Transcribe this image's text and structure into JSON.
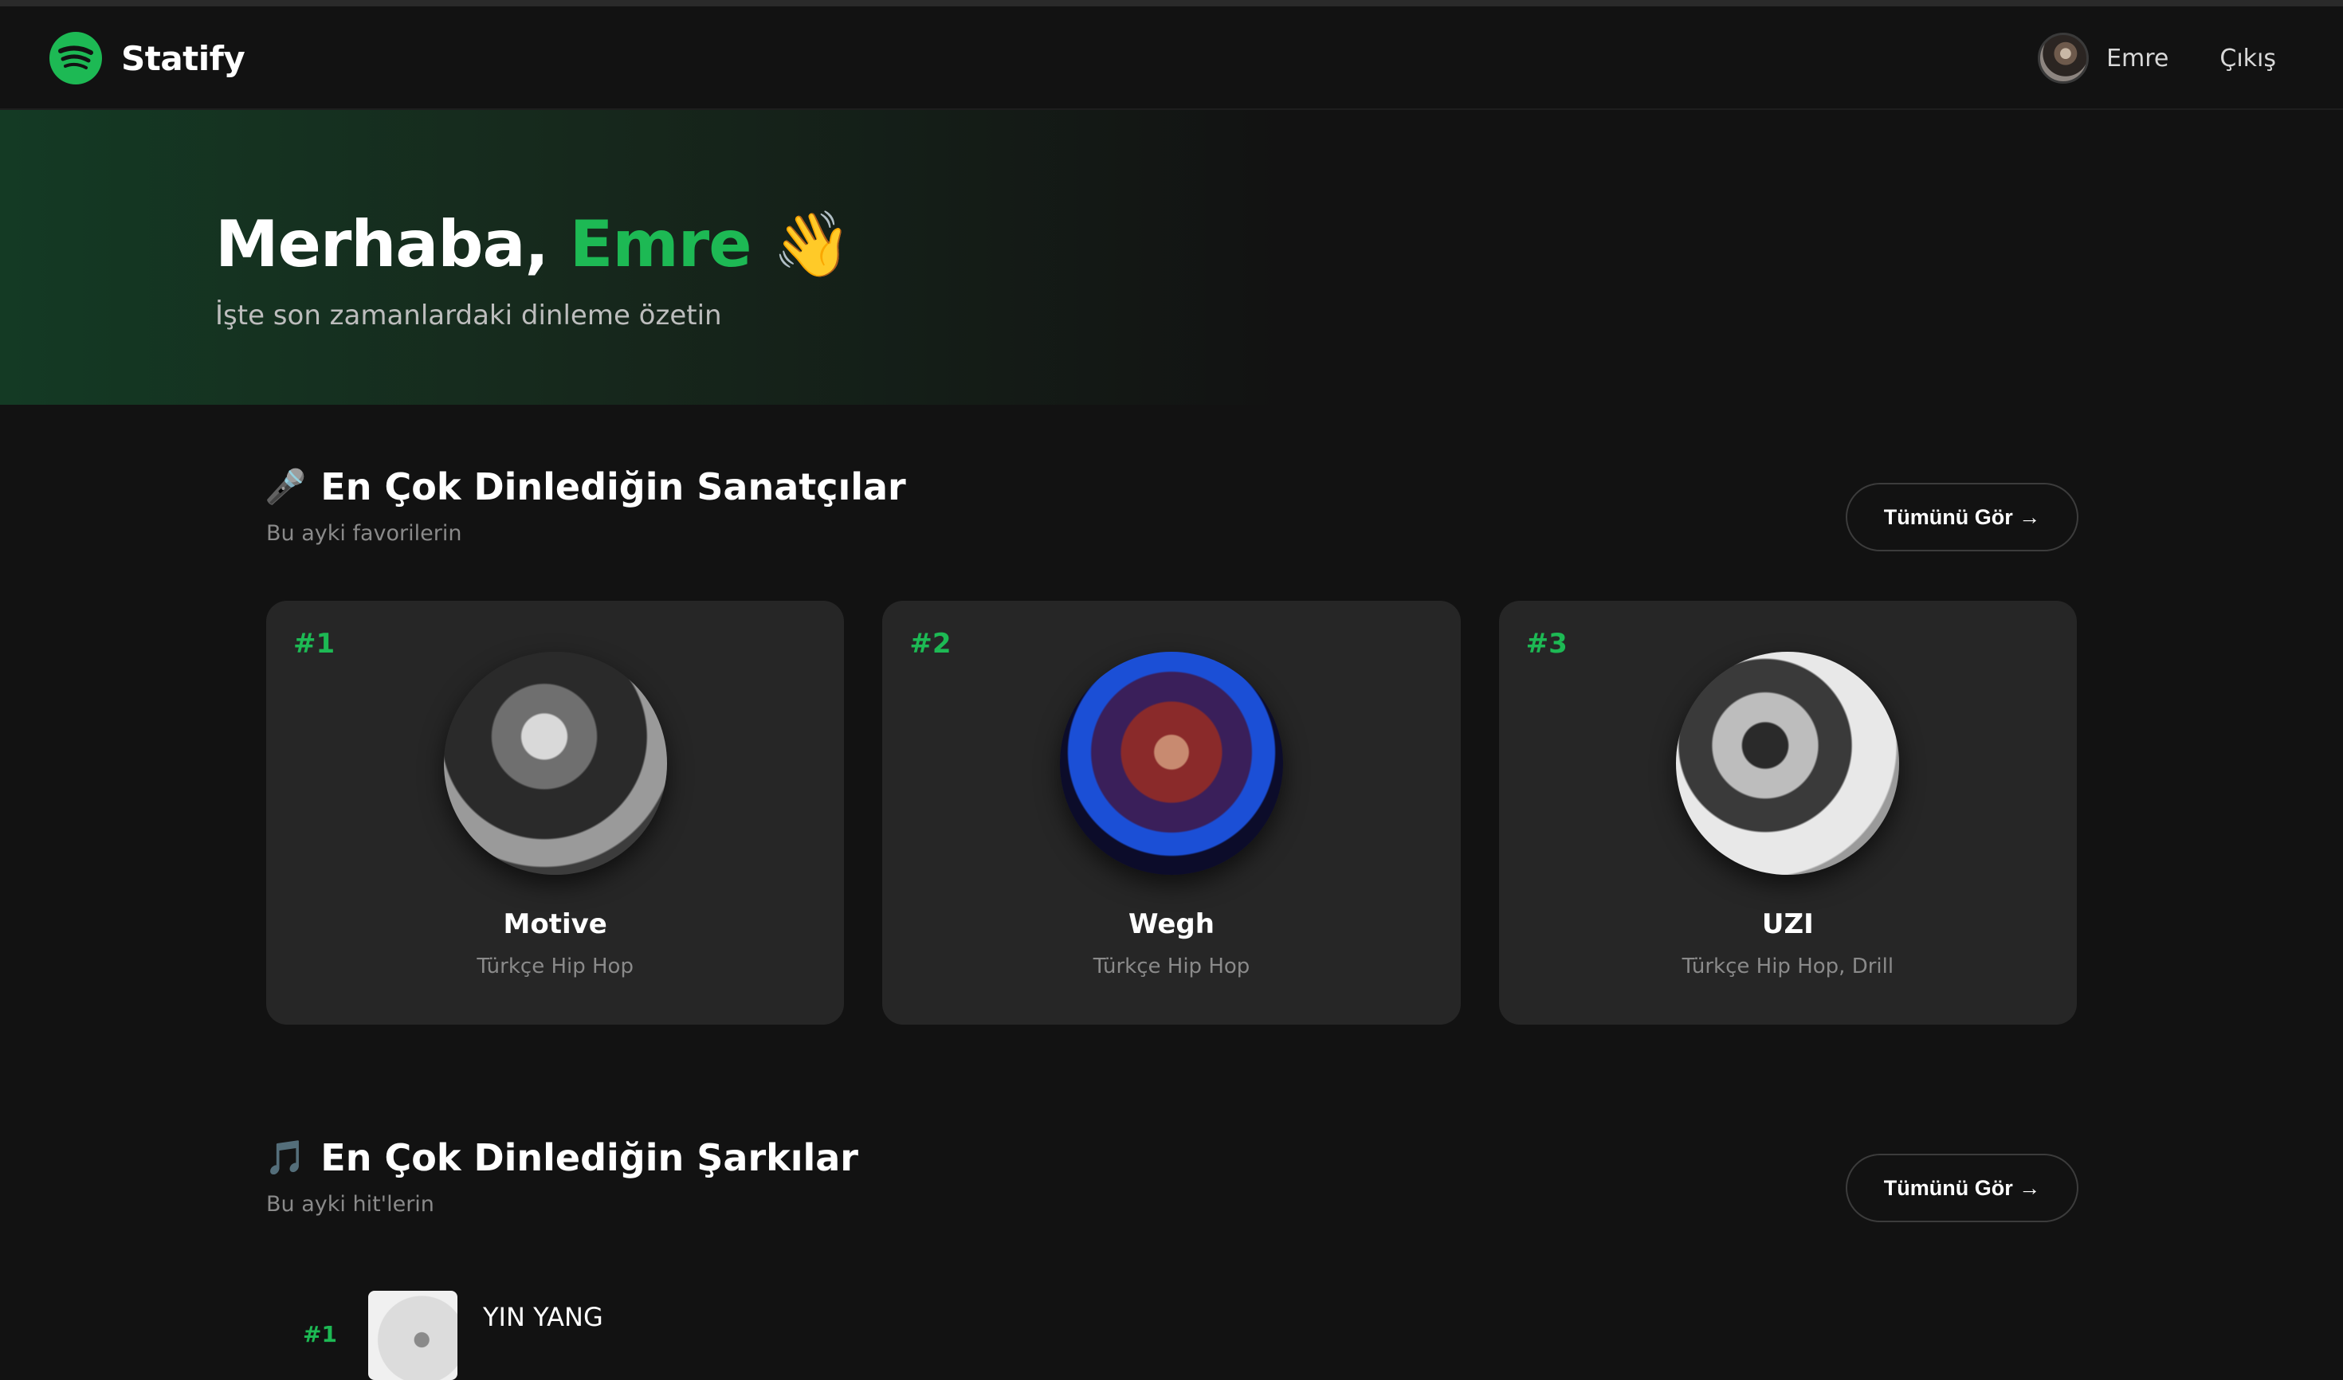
{
  "app": {
    "name": "Statify"
  },
  "nav": {
    "user_name": "Emre",
    "logout_label": "Çıkış"
  },
  "hero": {
    "greeting": "Merhaba, ",
    "name": "Emre",
    "emoji": "👋",
    "subtitle": "İşte son zamanlardaki dinleme özetin"
  },
  "artists_section": {
    "icon": "🎤",
    "title": "En Çok Dinlediğin Sanatçılar",
    "subtitle": "Bu ayki favorilerin",
    "see_all": "Tümünü Gör →",
    "items": [
      {
        "rank": "#1",
        "name": "Motive",
        "genre": "Türkçe Hip Hop"
      },
      {
        "rank": "#2",
        "name": "Wegh",
        "genre": "Türkçe Hip Hop"
      },
      {
        "rank": "#3",
        "name": "UZI",
        "genre": "Türkçe Hip Hop, Drill"
      }
    ]
  },
  "tracks_section": {
    "icon": "🎵",
    "title": "En Çok Dinlediğin Şarkılar",
    "subtitle": "Bu ayki hit'lerin",
    "see_all": "Tümünü Gör →",
    "items": [
      {
        "rank": "#1",
        "title": "YIN YANG"
      }
    ]
  },
  "colors": {
    "accent": "#1db954",
    "background": "#121212",
    "card": "#262626"
  }
}
